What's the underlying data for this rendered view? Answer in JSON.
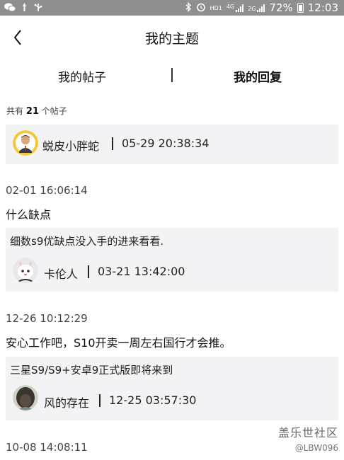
{
  "status_bar": {
    "icons_left": [
      "wechat-icon",
      "notification-icon",
      "usb-icon"
    ],
    "icons_right": [
      "bluetooth-icon",
      "alarm-icon",
      "hd-icon",
      "signal-4g-icon",
      "signal-2g-icon",
      "battery-icon"
    ],
    "hd_label": "HD1",
    "net_4g": "4G",
    "net_2g": "2G",
    "battery_percent": "72%",
    "time": "12:03"
  },
  "header": {
    "back_icon": "back-arrow-icon",
    "title": "我的主题"
  },
  "tabs": [
    {
      "label": "我的帖子",
      "active": false
    },
    {
      "label": "我的回复",
      "active": true
    }
  ],
  "summary": {
    "prefix": "共有",
    "count": "21",
    "suffix": "个帖子"
  },
  "first_card": {
    "name": "蜕皮小胖蛇",
    "timestamp": "05-29 20:38:34"
  },
  "items": [
    {
      "date": "02-01 16:06:14",
      "text": "什么缺点",
      "quote": {
        "text": "细数s9优缺点没入手的进来看看.",
        "name": "卡伦人",
        "timestamp": "03-21 13:42:00"
      }
    },
    {
      "date": "12-26 10:12:29",
      "text": "安心工作吧，S10开卖一周左右国行才会推。",
      "quote": {
        "text": "三星S9/S9+安卓9正式版即将来到",
        "name": "风的存在",
        "timestamp": "12-25 03:57:30"
      }
    },
    {
      "date": "10-08 14:08:11"
    }
  ],
  "watermark": {
    "brand": "盖乐世社区",
    "handle": "@LBW096"
  },
  "colors": {
    "status_bar_bg": "#8f8f8f",
    "card_bg": "#f3f3f5",
    "text": "#222222"
  }
}
